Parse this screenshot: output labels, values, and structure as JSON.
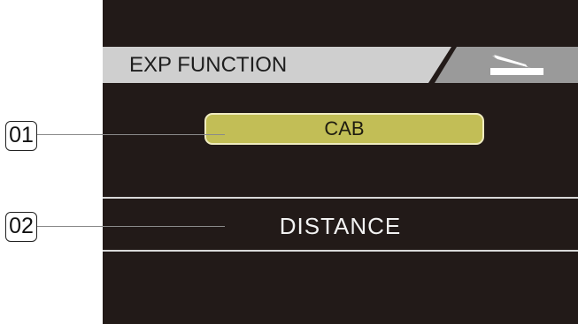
{
  "header": {
    "title": "EXP FUNCTION",
    "icon": "expression-pedal-icon"
  },
  "options": {
    "selected": "CAB",
    "next": "DISTANCE"
  },
  "callouts": [
    "01",
    "02"
  ],
  "colors": {
    "screen_bg": "#221a18",
    "header_bg": "#cfcfcf",
    "header_icon_bg": "#9a9a9a",
    "selected_bg": "#c2be56",
    "text_light": "#f2f2f2"
  }
}
